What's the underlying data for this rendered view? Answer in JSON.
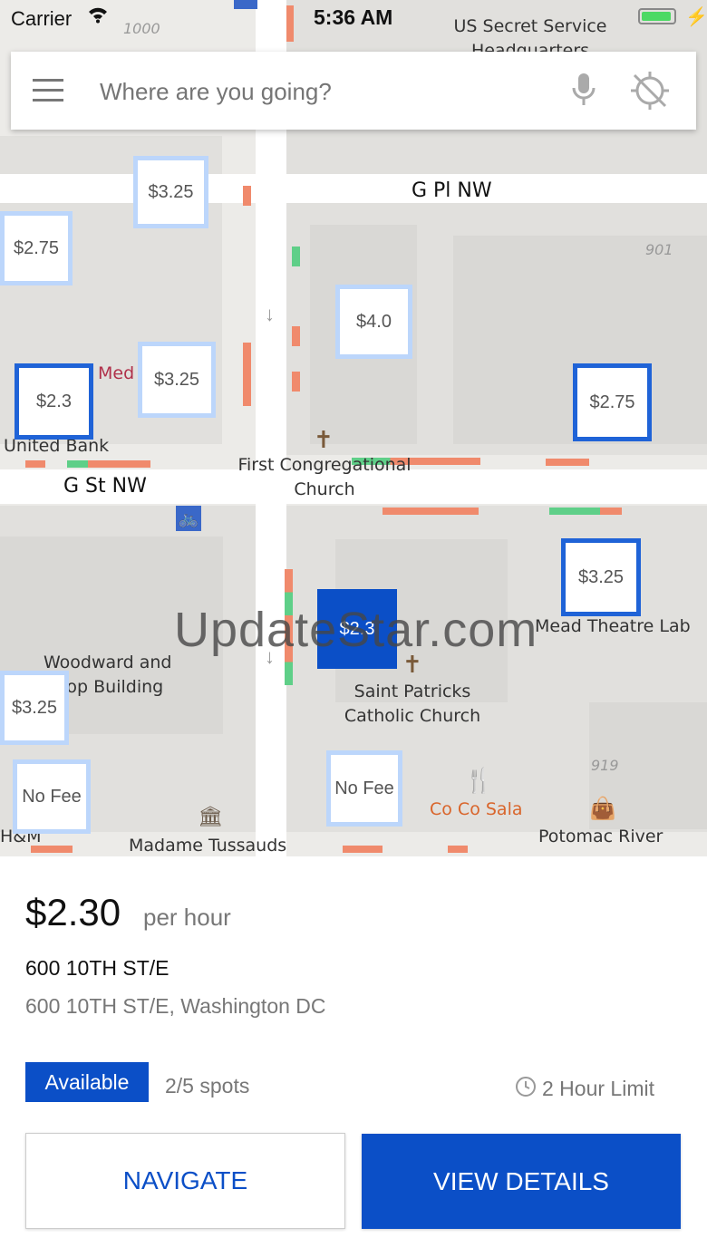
{
  "status_bar": {
    "carrier": "Carrier",
    "time": "5:36 AM"
  },
  "search": {
    "placeholder": "Where are you going?"
  },
  "map": {
    "streets": {
      "g_pl": "G Pl NW",
      "g_st": "G St NW"
    },
    "pois": {
      "secret_service": "US Secret Service Headquarters",
      "med": "Med",
      "united_bank": "United Bank",
      "first_church": "First Congregational Church",
      "woodward": "Woodward and",
      "lothrop": "rop Building",
      "mead": "Mead Theatre Lab",
      "saint_patricks": "Saint Patricks Catholic Church",
      "madame": "Madame Tussauds",
      "cocosala": "Co Co Sala",
      "potomac": "Potomac River",
      "hm": "H&M"
    },
    "building_numbers": {
      "n1000": "1000",
      "n901": "901",
      "n919": "919"
    },
    "pins": [
      {
        "label": "$3.25"
      },
      {
        "label": "$2.75"
      },
      {
        "label": "$4.0"
      },
      {
        "label": "$3.25"
      },
      {
        "label": "$2.3"
      },
      {
        "label": "$2.75"
      },
      {
        "label": "$3.25"
      },
      {
        "label": "$2.3"
      },
      {
        "label": "$3.25"
      },
      {
        "label": "No Fee"
      },
      {
        "label": "No Fee"
      }
    ],
    "watermark": "UpdateStar.com"
  },
  "details": {
    "price": "$2.30",
    "price_unit": "per hour",
    "name": "600 10TH ST/E",
    "address": "600 10TH ST/E, Washington DC",
    "status": "Available",
    "spots": "2/5 spots",
    "limit": "2 Hour Limit",
    "navigate_label": "NAVIGATE",
    "view_label": "VIEW DETAILS"
  },
  "colors": {
    "accent": "#0b4fc7",
    "available_bg": "#0b4fc7",
    "meter_red": "#f08a6c",
    "meter_green": "#5fcf88",
    "pin_border": "#bcd6fb"
  }
}
